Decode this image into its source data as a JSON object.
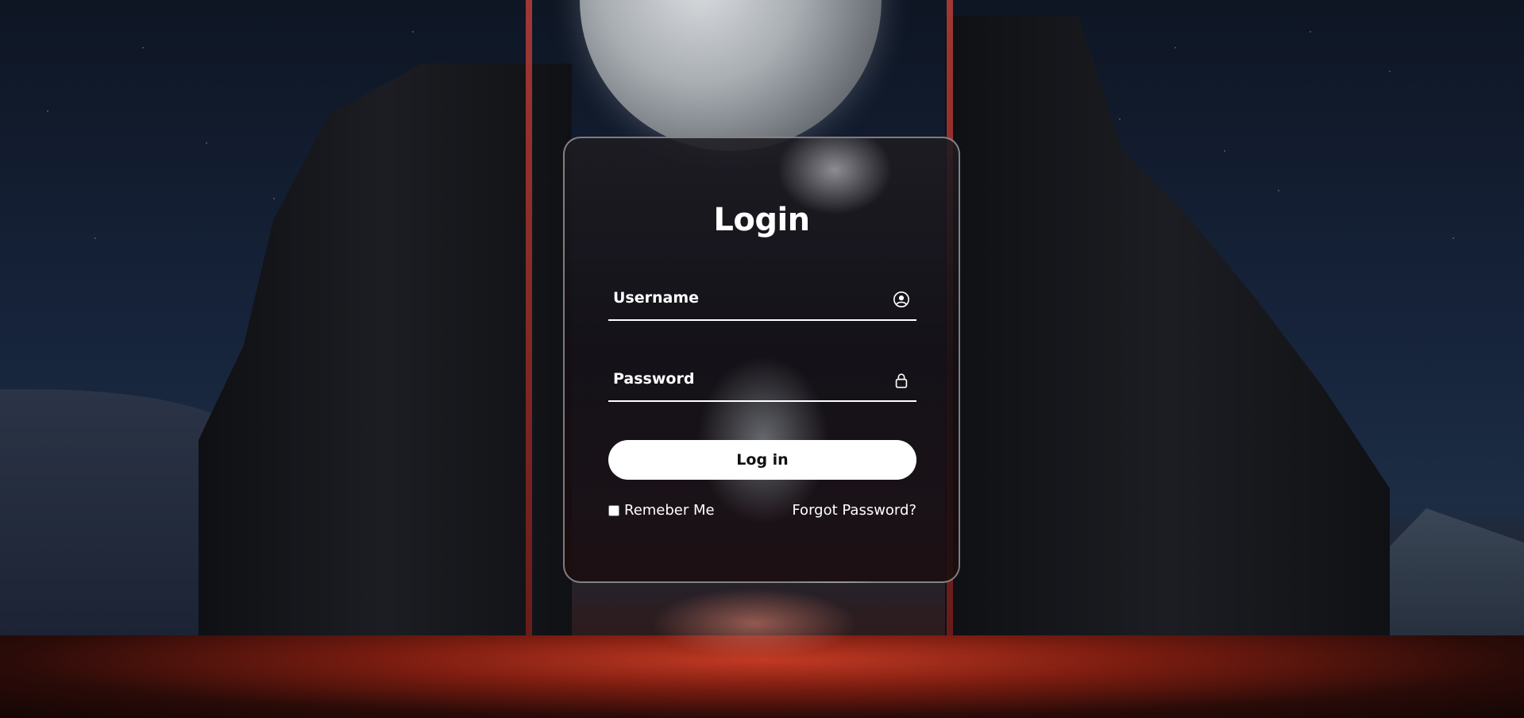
{
  "login_form": {
    "title": "Login",
    "username": {
      "placeholder": "Username",
      "value": "",
      "icon": "user-circle-icon"
    },
    "password": {
      "placeholder": "Password",
      "value": "",
      "icon": "lock-icon"
    },
    "submit_label": "Log in",
    "remember_label": "Remeber Me",
    "remember_checked": false,
    "forgot_label": "Forgot Password?"
  },
  "colors": {
    "text": "#ffffff",
    "button_bg": "#ffffff",
    "button_text": "#111111",
    "card_border": "#bfbfbf"
  }
}
